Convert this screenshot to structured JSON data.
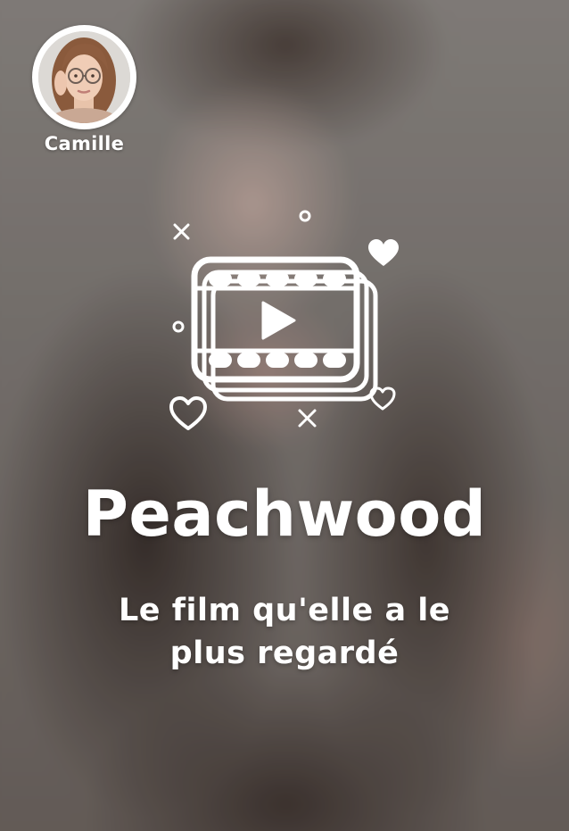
{
  "profile": {
    "name": "Camille",
    "avatar_icon": "user-portrait"
  },
  "illustration": {
    "icon": "film-reel-play-icon",
    "decorations": [
      "heart-icon",
      "heart-outline-icon",
      "sparkle-icon",
      "circle-dot-icon"
    ]
  },
  "content": {
    "title": "Peachwood",
    "subtitle": "Le film qu'elle a le plus regardé"
  },
  "colors": {
    "text": "#ffffff",
    "background": "#77716c"
  }
}
